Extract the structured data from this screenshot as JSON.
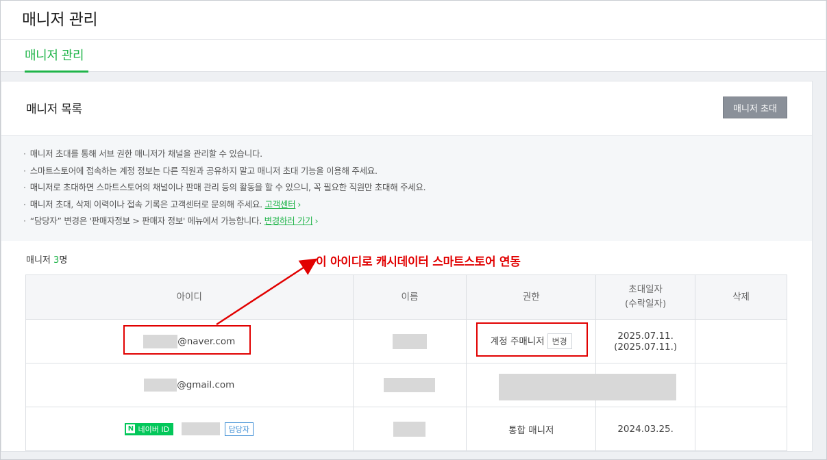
{
  "header": {
    "title": "매니저 관리",
    "tabs": [
      {
        "label": "매니저 관리",
        "active": true
      }
    ]
  },
  "card": {
    "title": "매니저 목록",
    "invite_button": "매니저 초대"
  },
  "notice": {
    "items": [
      {
        "text": "매니저 초대를 통해 서브 권한 매니저가 채널을 관리할 수 있습니다."
      },
      {
        "text": "스마트스토어에 접속하는 계정 정보는 다른 직원과 공유하지 말고 매니저 초대 기능을 이용해 주세요."
      },
      {
        "text": "매니저로 초대하면 스마트스토어의 채널이나 판매 관리 등의 활동을 할 수 있으니, 꼭 필요한 직원만 초대해 주세요."
      },
      {
        "text": "매니저 초대, 삭제 이력이나 접속 기록은 고객센터로 문의해 주세요.",
        "link": "고객센터"
      },
      {
        "text": "“담당자” 변경은 '판매자정보 > 판매자 정보' 메뉴에서 가능합니다.",
        "link": "변경하러 가기"
      }
    ]
  },
  "count": {
    "label": "매니저",
    "number": "3",
    "unit": "명"
  },
  "table": {
    "headers": {
      "id": "아이디",
      "name": "이름",
      "role": "권한",
      "invite_date": "초대일자",
      "accept_date": "(수락일자)",
      "delete": "삭제"
    },
    "rows": [
      {
        "id_suffix": "@naver.com",
        "role": "계정 주매니저",
        "change_label": "변경",
        "invite_date": "2025.07.11.",
        "accept_date": "(2025.07.11.)"
      },
      {
        "id_suffix": "@gmail.com"
      },
      {
        "badge": "네이버 ID",
        "badge_icon": "N",
        "tag": "담당자",
        "role": "통합 매니저",
        "invite_date": "2024.03.25."
      }
    ]
  },
  "annotation": {
    "text": "이 아이디로 캐시데이터 스마트스토어 연동",
    "color": "#e10000"
  },
  "colors": {
    "accent": "#1fb449",
    "naver_green": "#03c75a",
    "button_gray": "#8a9099"
  }
}
